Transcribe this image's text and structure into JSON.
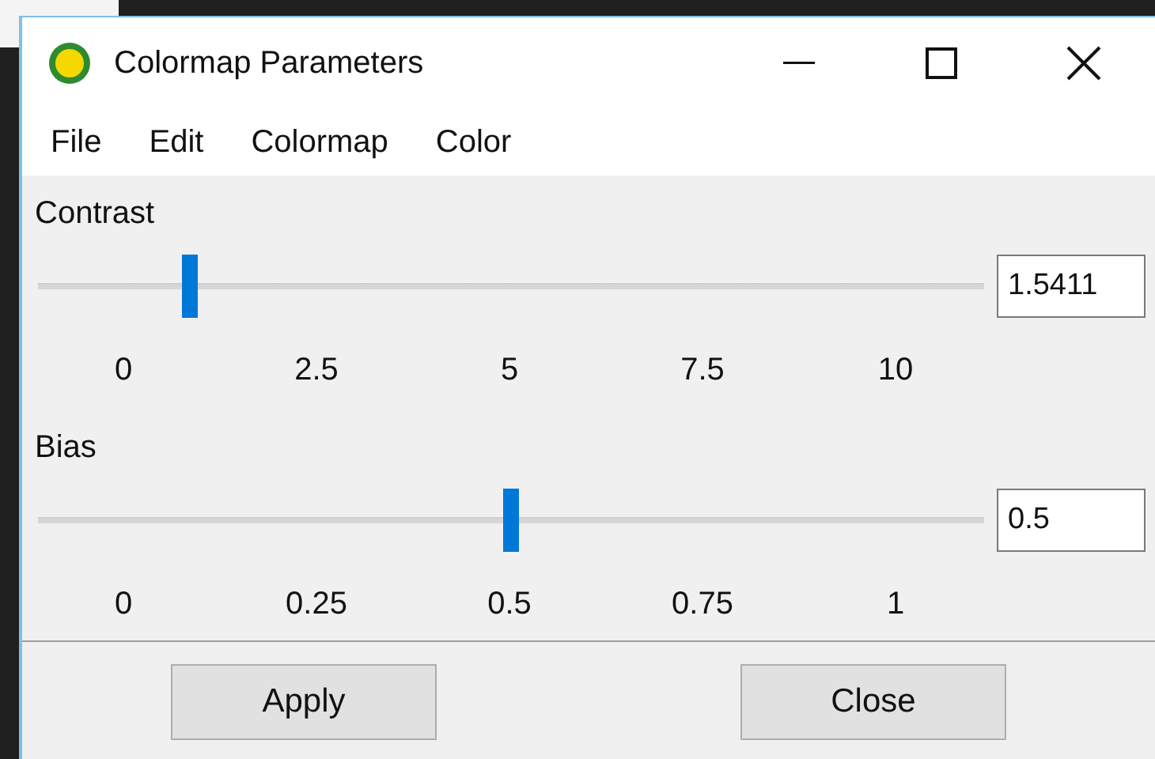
{
  "window": {
    "title": "Colormap Parameters"
  },
  "menu": [
    "File",
    "Edit",
    "Colormap",
    "Color"
  ],
  "sliders": [
    {
      "label": "Contrast",
      "level": 0.16,
      "value": "1.5411",
      "ticks": [
        "0",
        "2.5",
        "5",
        "7.5",
        "10"
      ]
    },
    {
      "label": "Bias",
      "level": 0.5,
      "value": "0.5",
      "ticks": [
        "0",
        "0.25",
        "0.5",
        "0.75",
        "1"
      ]
    }
  ],
  "buttons": [
    "Apply",
    "Close"
  ]
}
